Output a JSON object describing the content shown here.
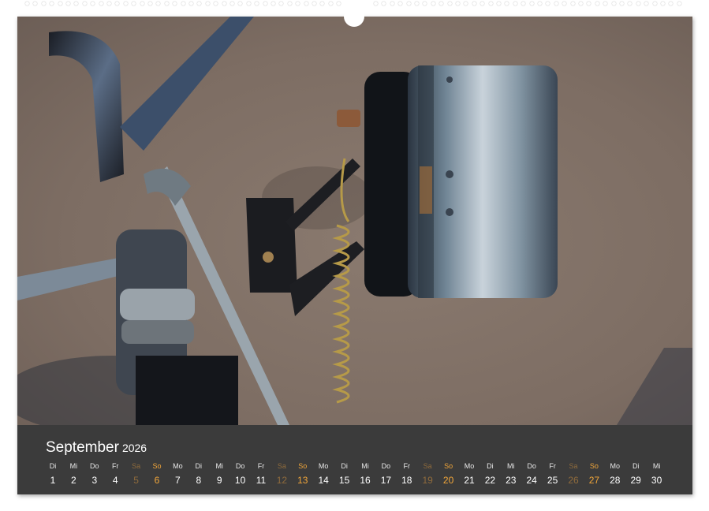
{
  "calendar": {
    "month": "September",
    "year": "2026",
    "days": [
      {
        "wd": "Di",
        "num": "1",
        "type": "weekday"
      },
      {
        "wd": "Mi",
        "num": "2",
        "type": "weekday"
      },
      {
        "wd": "Do",
        "num": "3",
        "type": "weekday"
      },
      {
        "wd": "Fr",
        "num": "4",
        "type": "weekday"
      },
      {
        "wd": "Sa",
        "num": "5",
        "type": "sat"
      },
      {
        "wd": "So",
        "num": "6",
        "type": "sun"
      },
      {
        "wd": "Mo",
        "num": "7",
        "type": "weekday"
      },
      {
        "wd": "Di",
        "num": "8",
        "type": "weekday"
      },
      {
        "wd": "Mi",
        "num": "9",
        "type": "weekday"
      },
      {
        "wd": "Do",
        "num": "10",
        "type": "weekday"
      },
      {
        "wd": "Fr",
        "num": "11",
        "type": "weekday"
      },
      {
        "wd": "Sa",
        "num": "12",
        "type": "sat"
      },
      {
        "wd": "So",
        "num": "13",
        "type": "sun"
      },
      {
        "wd": "Mo",
        "num": "14",
        "type": "weekday"
      },
      {
        "wd": "Di",
        "num": "15",
        "type": "weekday"
      },
      {
        "wd": "Mi",
        "num": "16",
        "type": "weekday"
      },
      {
        "wd": "Do",
        "num": "17",
        "type": "weekday"
      },
      {
        "wd": "Fr",
        "num": "18",
        "type": "weekday"
      },
      {
        "wd": "Sa",
        "num": "19",
        "type": "sat"
      },
      {
        "wd": "So",
        "num": "20",
        "type": "sun"
      },
      {
        "wd": "Mo",
        "num": "21",
        "type": "weekday"
      },
      {
        "wd": "Di",
        "num": "22",
        "type": "weekday"
      },
      {
        "wd": "Mi",
        "num": "23",
        "type": "weekday"
      },
      {
        "wd": "Do",
        "num": "24",
        "type": "weekday"
      },
      {
        "wd": "Fr",
        "num": "25",
        "type": "weekday"
      },
      {
        "wd": "Sa",
        "num": "26",
        "type": "sat"
      },
      {
        "wd": "So",
        "num": "27",
        "type": "sun"
      },
      {
        "wd": "Mo",
        "num": "28",
        "type": "weekday"
      },
      {
        "wd": "Di",
        "num": "29",
        "type": "weekday"
      },
      {
        "wd": "Mi",
        "num": "30",
        "type": "weekday"
      }
    ]
  },
  "colors": {
    "calendar_bar": "#3b3b3b",
    "saturday": "#8f6b3c",
    "sunday": "#f1a63a",
    "weekday": "#ffffff"
  }
}
